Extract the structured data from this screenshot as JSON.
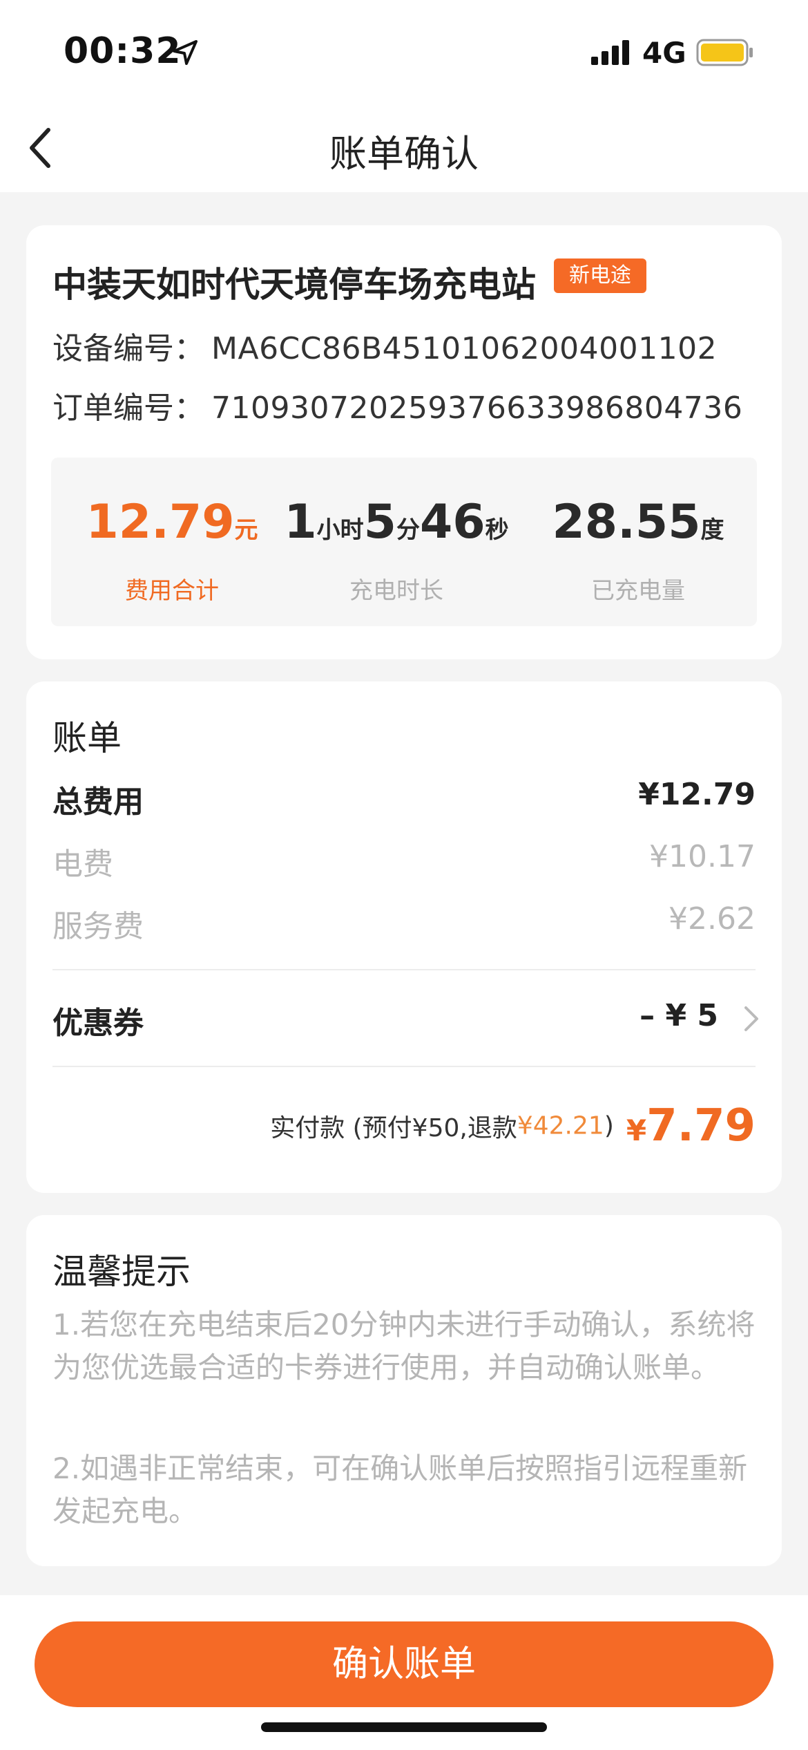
{
  "status_bar": {
    "time": "00:32",
    "network": "4G",
    "location_icon": "location-arrow-icon",
    "signal_icon": "signal-bars-icon",
    "battery_icon": "battery-icon",
    "battery_color": "#f5c518"
  },
  "nav": {
    "title": "账单确认",
    "back_icon": "chevron-left-icon"
  },
  "station": {
    "name": "中装天如时代天境停车场充电站",
    "brand_tag": "新电途",
    "device_label": "设备编号：",
    "device_no": "MA6CC86B4510106200400110​2",
    "order_label": "订单编号：",
    "order_no": "710930720259376633986804736"
  },
  "stats": {
    "cost_value": "12.79",
    "cost_unit": "元",
    "cost_label": "费用合计",
    "time_h": "1",
    "time_h_unit": "小时",
    "time_m": "5",
    "time_m_unit": "分",
    "time_s": "46",
    "time_s_unit": "秒",
    "time_label": "充电时长",
    "energy_value": "28.55",
    "energy_unit": "度",
    "energy_label": "已充电量"
  },
  "bill": {
    "title": "账单",
    "total_label": "总费用",
    "total_value": "¥12.79",
    "elec_label": "电费",
    "elec_value": "¥10.17",
    "service_label": "服务费",
    "service_value": "¥2.62",
    "coupon_label": "优惠券",
    "coupon_value": "– ¥ 5",
    "pay_prefix": "实付款 (预付¥50,退款",
    "pay_refund": "¥42.21",
    "pay_suffix": ")",
    "pay_yen": "¥",
    "pay_amount": "7.79"
  },
  "tips": {
    "title": "温馨提示",
    "tip1": "1.若您在充电结束后20分钟内未进行手动确认，系统将为您优选最合适的卡券进行使用，并自动确认账单。",
    "tip2": "2.如遇非正常结束，可在确认账单后按照指引远程重新发起充电。"
  },
  "footer": {
    "confirm_label": "确认账单",
    "accent_color": "#f56a26"
  }
}
